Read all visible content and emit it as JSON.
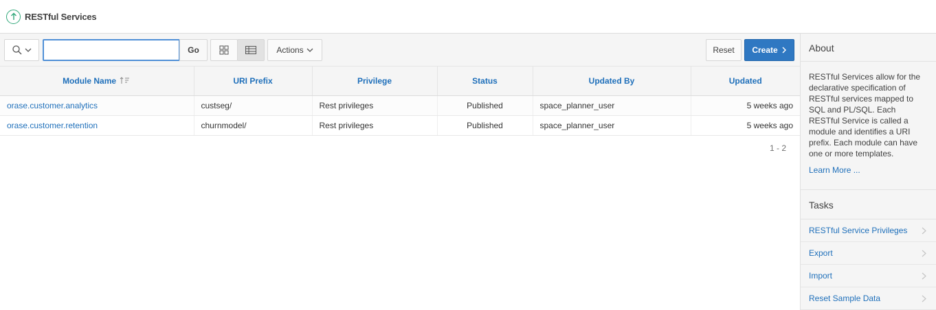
{
  "header": {
    "title": "RESTful Services",
    "logo_icon": "arrow-up-circle-icon"
  },
  "toolbar": {
    "search_placeholder": "",
    "go_label": "Go",
    "actions_label": "Actions",
    "reset_label": "Reset",
    "create_label": "Create"
  },
  "table": {
    "columns": [
      "Module Name",
      "URI Prefix",
      "Privilege",
      "Status",
      "Updated By",
      "Updated"
    ],
    "rows": [
      {
        "module_name": "orase.customer.analytics",
        "uri_prefix": "custseg/",
        "privilege": "Rest privileges",
        "status": "Published",
        "updated_by": "space_planner_user",
        "updated": "5 weeks ago"
      },
      {
        "module_name": "orase.customer.retention",
        "uri_prefix": "churnmodel/",
        "privilege": "Rest privileges",
        "status": "Published",
        "updated_by": "space_planner_user",
        "updated": "5 weeks ago"
      }
    ],
    "pagination": "1 - 2"
  },
  "sidebar": {
    "about_title": "About",
    "about_text": "RESTful Services allow for the declarative specification of RESTful services mapped to SQL and PL/SQL. Each RESTful Service is called a module and identifies a URI prefix. Each module can have one or more templates.",
    "learn_more": "Learn More ...",
    "tasks_title": "Tasks",
    "tasks": [
      {
        "label": "RESTful Service Privileges"
      },
      {
        "label": "Export"
      },
      {
        "label": "Import"
      },
      {
        "label": "Reset Sample Data"
      }
    ]
  },
  "colors": {
    "accent": "#1e6fba",
    "primary_button": "#2f78c2",
    "logo": "#2fa779"
  }
}
